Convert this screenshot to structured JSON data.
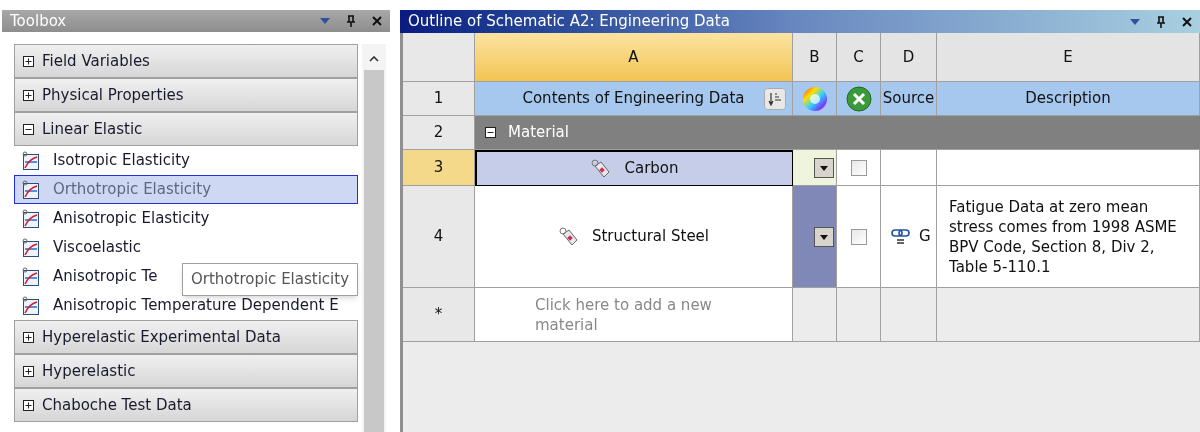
{
  "toolbox": {
    "title": "Toolbox",
    "groups": [
      {
        "label": "Field Variables",
        "expanded": false
      },
      {
        "label": "Physical Properties",
        "expanded": false
      },
      {
        "label": "Linear Elastic",
        "expanded": true,
        "items": [
          {
            "label": "Isotropic Elasticity",
            "selected": false
          },
          {
            "label": "Orthotropic Elasticity",
            "selected": true
          },
          {
            "label": "Anisotropic Elasticity",
            "selected": false
          },
          {
            "label": "Viscoelastic",
            "selected": false
          },
          {
            "label": "Anisotropic Te",
            "selected": false
          },
          {
            "label": "Anisotropic Temperature Dependent E",
            "selected": false
          }
        ]
      },
      {
        "label": "Hyperelastic Experimental Data",
        "expanded": false
      },
      {
        "label": "Hyperelastic",
        "expanded": false
      },
      {
        "label": "Chaboche Test Data",
        "expanded": false
      }
    ],
    "tooltip": "Orthotropic Elasticity"
  },
  "outline": {
    "title": "Outline of Schematic A2: Engineering Data",
    "columns": [
      {
        "letter": "A",
        "selected": true
      },
      {
        "letter": "B",
        "selected": false
      },
      {
        "letter": "C",
        "selected": false
      },
      {
        "letter": "D",
        "selected": false
      },
      {
        "letter": "E",
        "selected": false
      }
    ],
    "header_row": {
      "number": "1",
      "contents": "Contents of Engineering Data",
      "source": "Source",
      "description": "Description"
    },
    "rows": [
      {
        "kind": "group",
        "number": "2",
        "label": "Material",
        "expanded": true
      },
      {
        "kind": "material",
        "number": "3",
        "name": "Carbon",
        "selected": true,
        "color": "#eef5dc",
        "checked": false
      },
      {
        "kind": "material",
        "number": "4",
        "name": "Structural Steel",
        "selected": false,
        "color": "#8088b8",
        "checked": false,
        "source": "G",
        "description": "Fatigue Data at zero mean stress comes from 1998 ASME BPV Code, Section 8, Div 2, Table 5-110.1"
      },
      {
        "kind": "new",
        "number": "*",
        "placeholder": "Click here to add a new material"
      }
    ]
  }
}
